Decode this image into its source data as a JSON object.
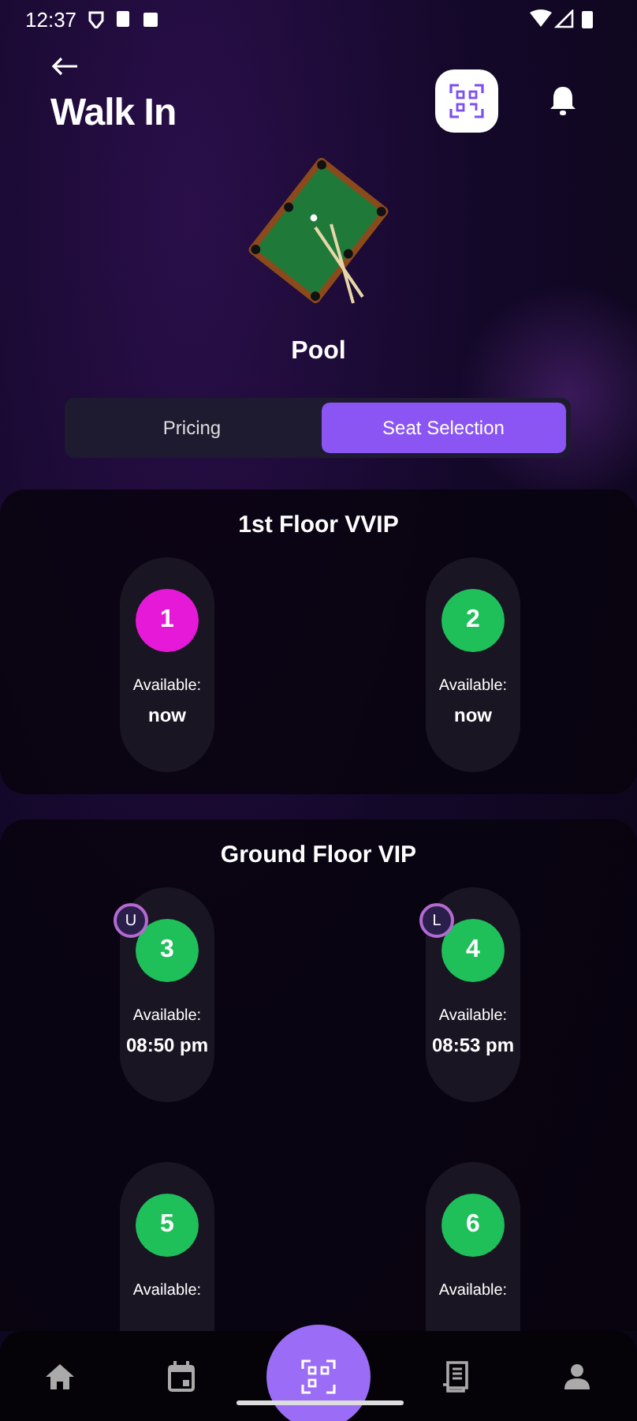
{
  "status_bar": {
    "time": "12:37"
  },
  "header": {
    "title": "Walk In"
  },
  "game": {
    "name": "Pool"
  },
  "tabs": [
    {
      "label": "Pricing",
      "selected": false
    },
    {
      "label": "Seat Selection",
      "selected": true
    }
  ],
  "sections": [
    {
      "title": "1st Floor VVIP",
      "seats": [
        {
          "number": "1",
          "color": "#e619d9",
          "label": "Available:",
          "time": "now"
        },
        {
          "number": "2",
          "color": "#1fbf5a",
          "label": "Available:",
          "time": "now"
        }
      ]
    },
    {
      "title": "Ground Floor VIP",
      "seats": [
        {
          "number": "3",
          "color": "#1fbf5a",
          "badge": "U",
          "label": "Available:",
          "time": "08:50 pm"
        },
        {
          "number": "4",
          "color": "#1fbf5a",
          "badge": "L",
          "label": "Available:",
          "time": "08:53 pm"
        },
        {
          "number": "5",
          "color": "#1fbf5a",
          "label": "Available:"
        },
        {
          "number": "6",
          "color": "#1fbf5a",
          "label": "Available:"
        }
      ]
    }
  ],
  "nav": [
    {
      "kind": "home",
      "selected": false
    },
    {
      "kind": "calendar",
      "selected": false
    },
    {
      "kind": "scan",
      "selected": true
    },
    {
      "kind": "receipt",
      "selected": false
    },
    {
      "kind": "profile",
      "selected": false
    }
  ]
}
